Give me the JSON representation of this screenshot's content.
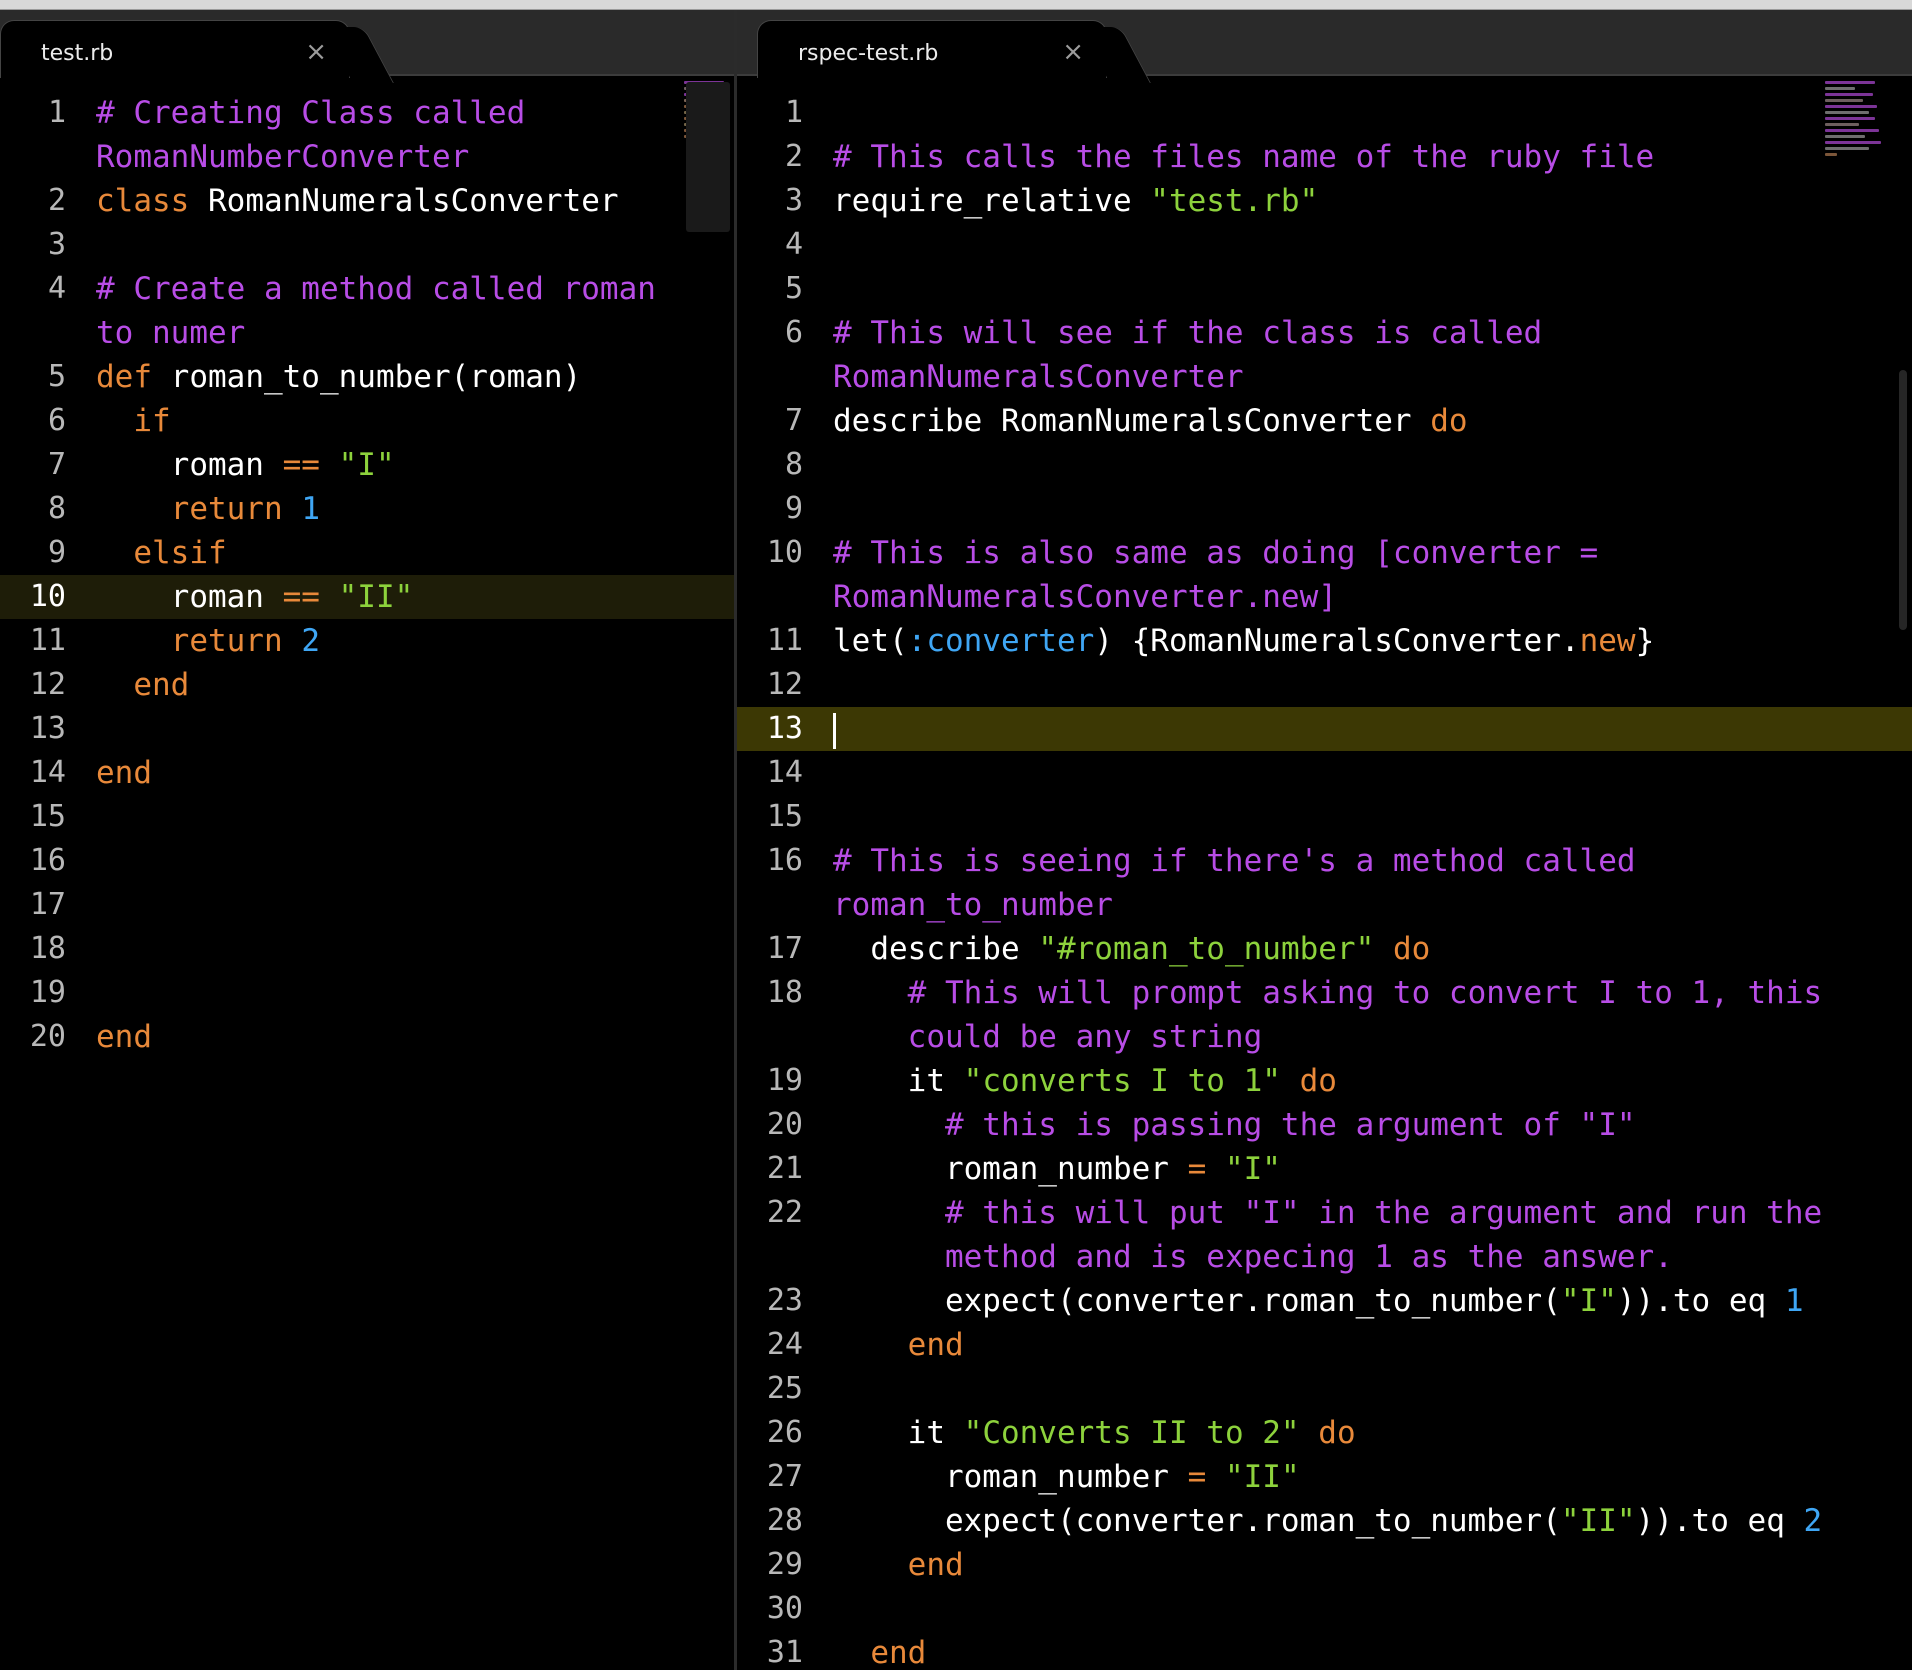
{
  "left": {
    "tab_label": "test.rb",
    "tab_close": "×",
    "current_line": 10
  },
  "right": {
    "tab_label": "rspec-test.rb",
    "tab_close": "×",
    "current_line": 13
  },
  "colors": {
    "comment": "#b84de6",
    "keyword": "#e8893a",
    "string": "#8dd23c",
    "number": "#3fa6f4",
    "current_line_left": "#1e1d08",
    "current_line_right": "#3c3804"
  }
}
